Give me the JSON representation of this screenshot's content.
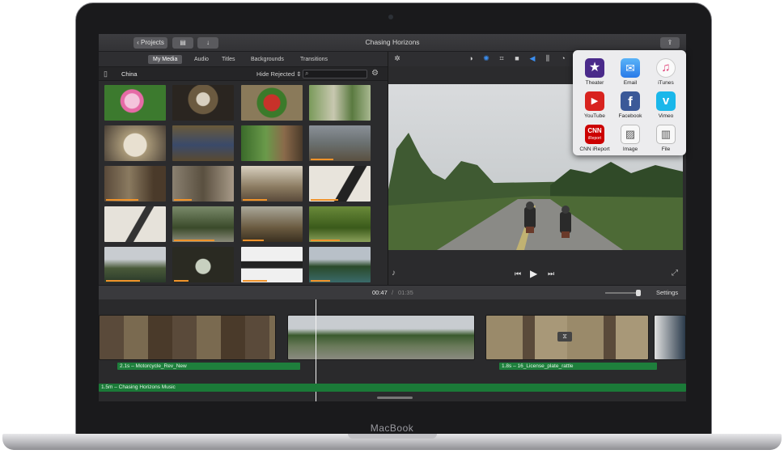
{
  "device": {
    "brand": "MacBook"
  },
  "window": {
    "title": "Chasing Horizons"
  },
  "toolbar": {
    "projects_label": "Projects"
  },
  "media": {
    "tabs": [
      "My Media",
      "Audio",
      "Titles",
      "Backgrounds",
      "Transitions"
    ],
    "library_name": "China",
    "filter_label": "Hide Rejected"
  },
  "timeline": {
    "current_time": "00:47",
    "separator": "/",
    "total_time": "01:35",
    "settings_label": "Settings",
    "audio_clips": [
      "2.1s – Motorcycle_Rev_New",
      "1.8s – 16_License_plate_rattle"
    ],
    "music_clip": "1.5m – Chasing Horizons Music"
  },
  "share": {
    "items": [
      "Theater",
      "Email",
      "iTunes",
      "YouTube",
      "Facebook",
      "Vimeo",
      "CNN iReport",
      "Image",
      "File"
    ],
    "cnn_badge": "CNN",
    "cnn_sub": "iReport"
  },
  "colors": {
    "accent": "#3b8ef0",
    "audio_green": "#1e7f3c",
    "used_orange": "#f0932b"
  }
}
